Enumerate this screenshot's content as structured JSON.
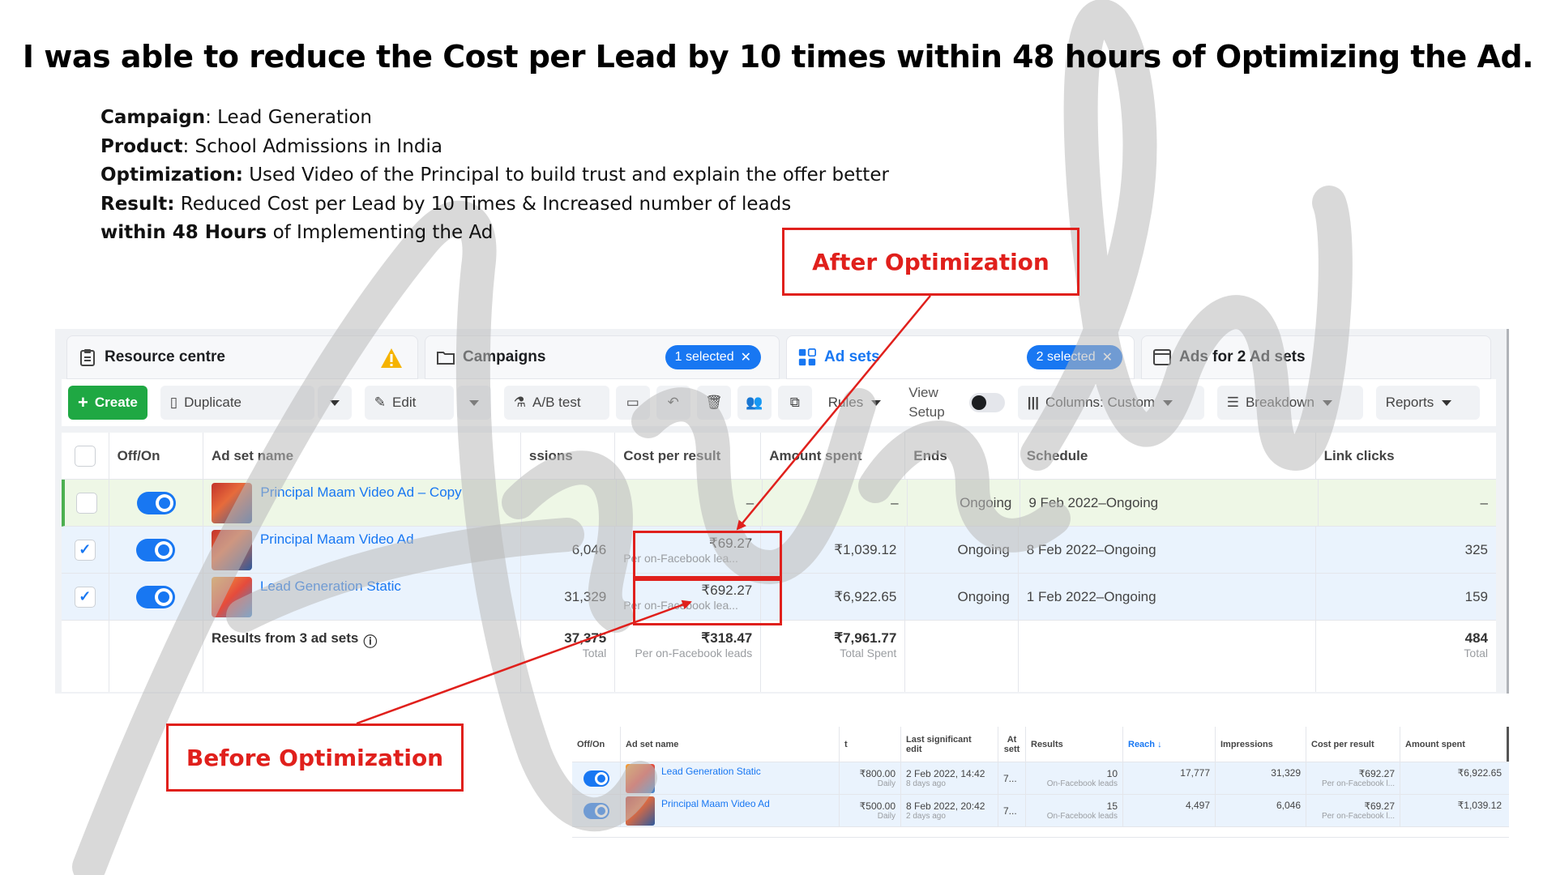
{
  "headline": "I was able to reduce the Cost per Lead by 10 times within 48 hours of Optimizing the Ad.",
  "details": [
    {
      "label": "Campaign",
      "sep": ": ",
      "text": "Lead Generation"
    },
    {
      "label": "Product",
      "sep": ": ",
      "text": "School Admissions in India"
    },
    {
      "label": "Optimization:",
      "sep": " ",
      "text": "Used Video of the Principal to build trust and explain the offer better"
    },
    {
      "label": "Result:",
      "sep": " ",
      "text": "Reduced Cost per Lead by 10 Times & Increased number of leads"
    },
    {
      "label": "within 48 Hours",
      "sep": " ",
      "text": "of Implementing the Ad"
    }
  ],
  "callouts": {
    "after": "After Optimization",
    "before": "Before Optimization"
  },
  "watermark": "Anirudh",
  "colors": {
    "accent_red": "#e0201c",
    "brand_blue": "#1877f2",
    "create_green": "#1fa843"
  },
  "tabs": {
    "resource": "Resource centre",
    "campaigns": "Campaigns",
    "campaigns_pill": "1 selected",
    "adsets": "Ad sets",
    "adsets_pill": "2 selected",
    "ads": "Ads for 2 Ad sets"
  },
  "toolbar": {
    "create": "Create",
    "duplicate": "Duplicate",
    "edit": "Edit",
    "ab_test": "A/B test",
    "rules": "Rules",
    "view_setup_1": "View",
    "view_setup_2": "Setup",
    "columns": "Columns: Custom",
    "breakdown": "Breakdown",
    "reports": "Reports"
  },
  "table": {
    "headers": {
      "offon": "Off/On",
      "name": "Ad set name",
      "impressions": "ssions",
      "cpr": "Cost per result",
      "amount": "Amount spent",
      "ends": "Ends",
      "schedule": "Schedule",
      "clicks": "Link clicks"
    },
    "rows": [
      {
        "name": "Principal Maam Video Ad – Copy",
        "impressions": "",
        "cpr": "–",
        "cpr_sub": "",
        "amount": "–",
        "ends": "Ongoing",
        "schedule": "9 Feb 2022–Ongoing",
        "clicks": "–",
        "checked": ""
      },
      {
        "name": "Principal Maam Video Ad",
        "impressions": "6,046",
        "cpr": "₹69.27",
        "cpr_sub": "Per on-Facebook lea...",
        "amount": "₹1,039.12",
        "ends": "Ongoing",
        "schedule": "8 Feb 2022–Ongoing",
        "clicks": "325",
        "checked": "✓"
      },
      {
        "name": "Lead Generation Static",
        "impressions": "31,329",
        "cpr": "₹692.27",
        "cpr_sub": "Per on-Facebook lea...",
        "amount": "₹6,922.65",
        "ends": "Ongoing",
        "schedule": "1 Feb 2022–Ongoing",
        "clicks": "159",
        "checked": "✓"
      }
    ],
    "totals": {
      "label": "Results from 3 ad sets",
      "impressions": "37,375",
      "impressions_sub": "Total",
      "cpr": "₹318.47",
      "cpr_sub": "Per on-Facebook leads",
      "amount": "₹7,961.77",
      "amount_sub": "Total Spent",
      "clicks": "484",
      "clicks_sub": "Total"
    }
  },
  "small_table": {
    "headers": {
      "offon": "Off/On",
      "name": "Ad set name",
      "budget": "t",
      "last_edit_1": "Last significant",
      "last_edit_2": "edit",
      "att_1": "At",
      "att_2": "sett",
      "results": "Results",
      "reach": "Reach ↓",
      "impressions": "Impressions",
      "cpr": "Cost per result",
      "amount": "Amount spent"
    },
    "rows": [
      {
        "name": "Lead Generation Static",
        "budget": "₹800.00",
        "budget_sub": "Daily",
        "last_edit": "2 Feb 2022, 14:42",
        "last_edit_sub": "8 days ago",
        "att": "7...",
        "results": "10",
        "results_sub": "On-Facebook leads",
        "reach": "17,777",
        "impressions": "31,329",
        "cpr": "₹692.27",
        "cpr_sub": "Per on-Facebook l...",
        "amount": "₹6,922.65"
      },
      {
        "name": "Principal Maam Video Ad",
        "budget": "₹500.00",
        "budget_sub": "Daily",
        "last_edit": "8 Feb 2022, 20:42",
        "last_edit_sub": "2 days ago",
        "att": "7...",
        "results": "15",
        "results_sub": "On-Facebook leads",
        "reach": "4,497",
        "impressions": "6,046",
        "cpr": "₹69.27",
        "cpr_sub": "Per on-Facebook l...",
        "amount": "₹1,039.12"
      }
    ]
  }
}
